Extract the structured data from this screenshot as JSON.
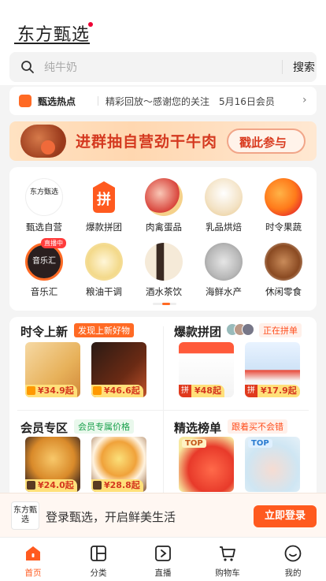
{
  "header": {
    "logo_text": "东方甄选",
    "search_placeholder": "纯牛奶",
    "search_button": "搜索"
  },
  "notice": {
    "title": "甄选热点",
    "text": "精彩回放～感谢您的关注　5月16日会员"
  },
  "banner": {
    "title": "进群抽自营劲干牛肉",
    "cta": "戳此参与"
  },
  "categories": [
    {
      "label": "甄选自营",
      "icon": "brand-logo-icon"
    },
    {
      "label": "爆款拼团",
      "icon": "group-buy-icon",
      "glyph": "拼"
    },
    {
      "label": "肉禽蛋品",
      "icon": "meat-icon"
    },
    {
      "label": "乳品烘焙",
      "icon": "milk-icon"
    },
    {
      "label": "时令果蔬",
      "icon": "fruit-icon"
    },
    {
      "label": "音乐汇",
      "icon": "music-icon",
      "badge": "直播中",
      "glyph": "音乐汇"
    },
    {
      "label": "粮油干调",
      "icon": "oil-icon"
    },
    {
      "label": "酒水茶饮",
      "icon": "wine-icon"
    },
    {
      "label": "海鲜水产",
      "icon": "seafood-icon"
    },
    {
      "label": "休闲零食",
      "icon": "snack-icon"
    }
  ],
  "sections": {
    "seasonal": {
      "title": "时令上新",
      "tag": "发现上新好物",
      "items": [
        {
          "price": "¥34.9起"
        },
        {
          "price": "¥46.6起"
        }
      ]
    },
    "groupbuy": {
      "title": "爆款拼团",
      "tag": "正在拼单",
      "items": [
        {
          "price": "¥48起",
          "glyph": "拼"
        },
        {
          "price": "¥17.9起",
          "glyph": "拼"
        }
      ]
    },
    "member": {
      "title": "会员专区",
      "tag": "会员专属价格",
      "items": [
        {
          "price": "¥24.0起"
        },
        {
          "price": "¥28.8起"
        }
      ]
    },
    "ranking": {
      "title": "精选榜单",
      "tag": "跟着买不会错",
      "items": [
        {
          "badge": "TOP"
        },
        {
          "badge": "TOP"
        }
      ]
    }
  },
  "login": {
    "text": "登录甄选，开启鲜美生活",
    "button": "立即登录",
    "logo_text": "东方甄选"
  },
  "tabs": [
    {
      "label": "首页",
      "icon": "home-icon",
      "active": true
    },
    {
      "label": "分类",
      "icon": "category-icon",
      "active": false
    },
    {
      "label": "直播",
      "icon": "live-icon",
      "active": false
    },
    {
      "label": "购物车",
      "icon": "cart-icon",
      "active": false
    },
    {
      "label": "我的",
      "icon": "profile-icon",
      "active": false
    }
  ],
  "colors": {
    "accent": "#ff5a1f",
    "banner_text": "#d4381f",
    "member_tag": "#19a04b"
  }
}
